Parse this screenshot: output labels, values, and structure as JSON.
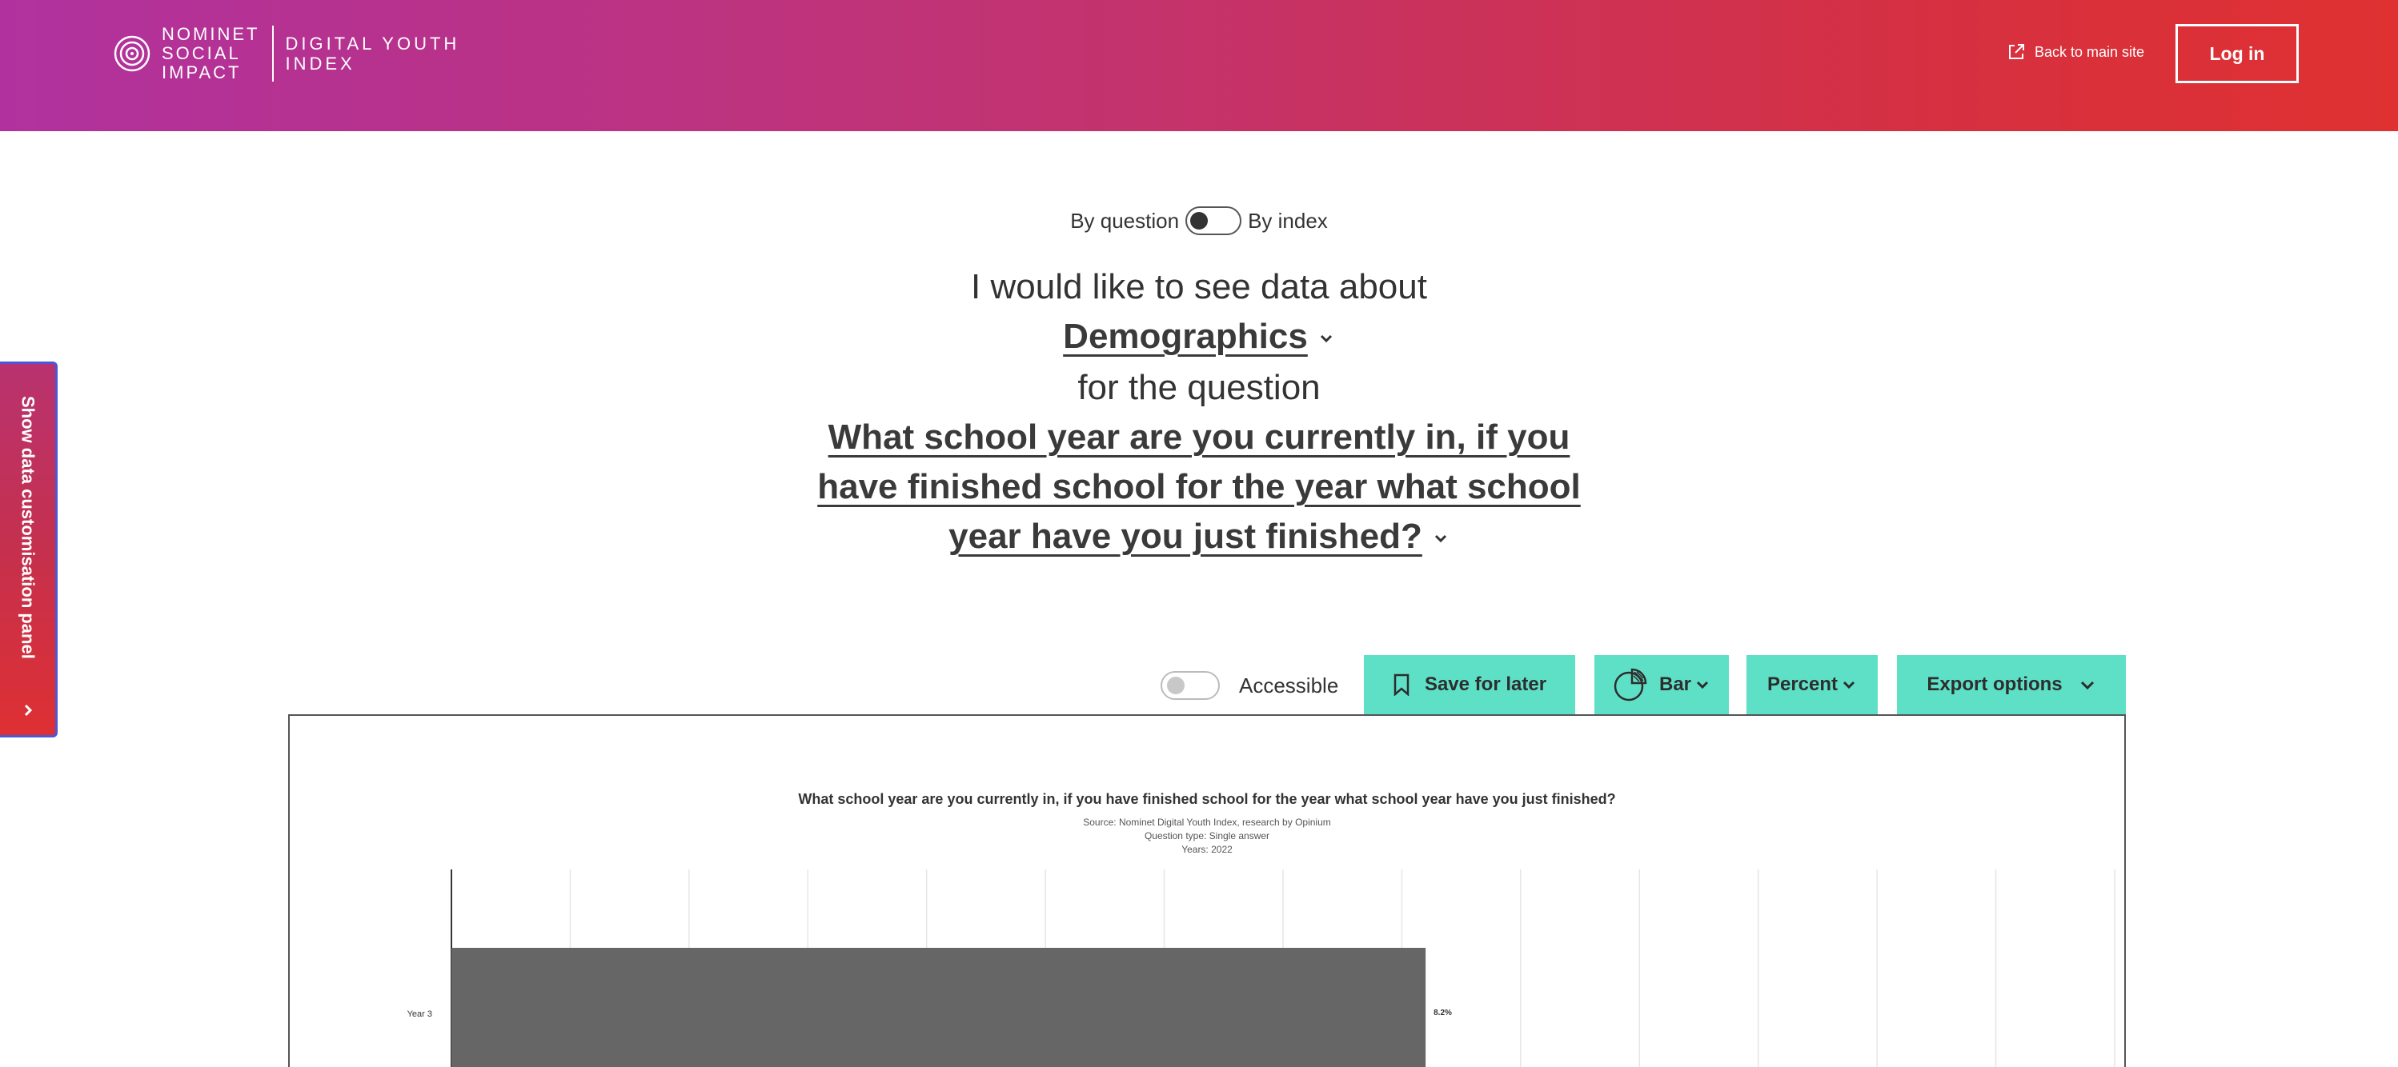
{
  "header": {
    "logo_lines": [
      "NOMINET",
      "SOCIAL",
      "IMPACT"
    ],
    "product_lines": [
      "DIGITAL YOUTH",
      "INDEX"
    ],
    "back_link": "Back to main site",
    "login": "Log in",
    "gradient": [
      "#b1329f",
      "#df3132"
    ]
  },
  "side_panel": {
    "label": "Show data customisation panel"
  },
  "mode_toggle": {
    "left_label": "By question",
    "right_label": "By index"
  },
  "query": {
    "intro": "I would like to see data about",
    "topic": "Demographics",
    "connector": "for the question",
    "question_lines": [
      "What school year are you currently in, if you",
      "have finished school for the year what school",
      "year have you just finished?"
    ]
  },
  "toolbar": {
    "accessible_label": "Accessible",
    "save_label": "Save for later",
    "chart_type_label": "Bar",
    "value_mode_label": "Percent",
    "export_label": "Export options",
    "accent": "#5ee0c7"
  },
  "chart_data": {
    "type": "bar",
    "orientation": "horizontal",
    "title": "What school year are you currently in, if you have finished school for the year what school year have you just finished?",
    "subtitle_lines": [
      "Source: Nominet Digital Youth Index, research by Opinium",
      "Question type: Single answer",
      "Years: 2022"
    ],
    "categories": [
      "Year 3"
    ],
    "values": [
      8.2
    ],
    "value_labels": [
      "8.2%"
    ],
    "xlim": [
      0,
      14
    ],
    "grid": true,
    "bar_color": "#666666"
  }
}
